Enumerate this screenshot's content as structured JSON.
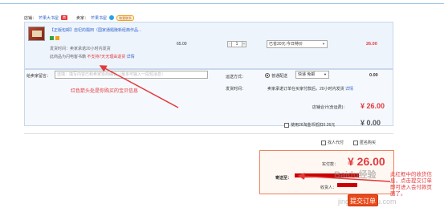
{
  "store": {
    "shop_label": "店铺：",
    "shop_name": "芒果大书屋",
    "shop_tag": "商",
    "seller_label": "卖家：",
    "seller_name": "芒果书屋",
    "seller_badge": "和我联系"
  },
  "item": {
    "title": "【正版包邮】自杞的瓢田（国家通题陵新经典作品...",
    "meta_line1": "发货时间：卖家承诺20小时内发货",
    "meta_line2_prefix": "此商品为闪电客书籍",
    "meta_line2_suffix": "不支持7天无理由退货",
    "detail_link": "详情",
    "price": "65.00",
    "quantity": "1",
    "qty_minus": "-",
    "qty_plus": "+",
    "promo_option": "已省20元:今日特价",
    "subtotal": "26.00"
  },
  "message": {
    "label": "给卖家留言：",
    "placeholder": "选填：填写内容已和卖家协商确认（最多可输入一段短消息）"
  },
  "shipping": {
    "label": "运送方式：",
    "option": "普通配送",
    "method": "快递 免邮",
    "price": "0.00",
    "delivery_label": "发货时间：",
    "delivery_text": "卖家承诺订单在买家付款后，20小时内发货",
    "delivery_link": "详情"
  },
  "annotation_left": "红色箭头处是你购买的宝贝信息",
  "store_total": {
    "label": "店铺合计(含运费)：",
    "value": "¥ 26.00"
  },
  "coins": {
    "label": "使用26淘金币抵扣0.26元",
    "value": "¥ 0.00"
  },
  "options": {
    "proxy_pay": "找人代付",
    "anonymous": "匿名购买"
  },
  "confirm": {
    "pay_label": "实付款：",
    "pay_value": "¥ 26.00",
    "ship_to_label": "寄送至：",
    "receiver_label": "收货人：",
    "submit": "提交订单"
  },
  "annotation_right": "此红框中的收货信息，点击提交订单即可进入会付款页面了。",
  "watermark": "Baidu经验",
  "watermark_sub": "jingyan.baidu.com",
  "colors": {
    "accent_red": "#e4393c",
    "submit_orange": "#e84c1c",
    "link_blue": "#3366cc"
  }
}
